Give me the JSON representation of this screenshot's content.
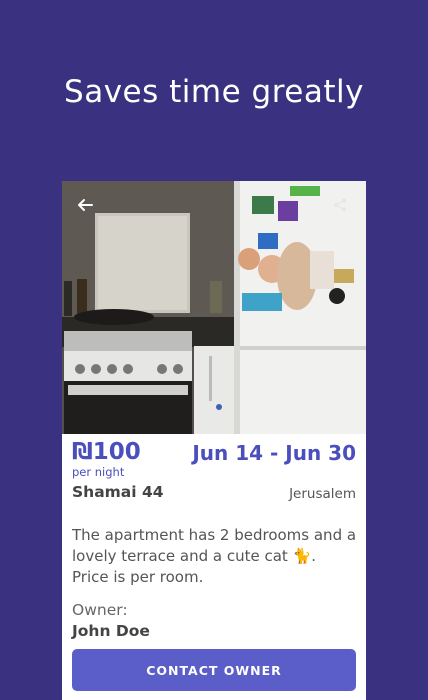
{
  "headline": "Saves time greatly",
  "listing": {
    "price": "₪100",
    "price_unit": "per night",
    "dates": "Jun 14 - Jun 30",
    "address": "Shamai 44",
    "city": "Jerusalem",
    "description": "The apartment has 2 bedrooms and a lovely terrace and a cute cat 🐈.\nPrice is per room.",
    "owner_label": "Owner:",
    "owner_name": "John Doe",
    "contact_label": "CONTACT OWNER"
  },
  "icons": {
    "back": "back-arrow-icon",
    "share": "share-icon"
  },
  "colors": {
    "background": "#3a3180",
    "accent": "#4b4fbb",
    "button": "#5b5ec9"
  }
}
